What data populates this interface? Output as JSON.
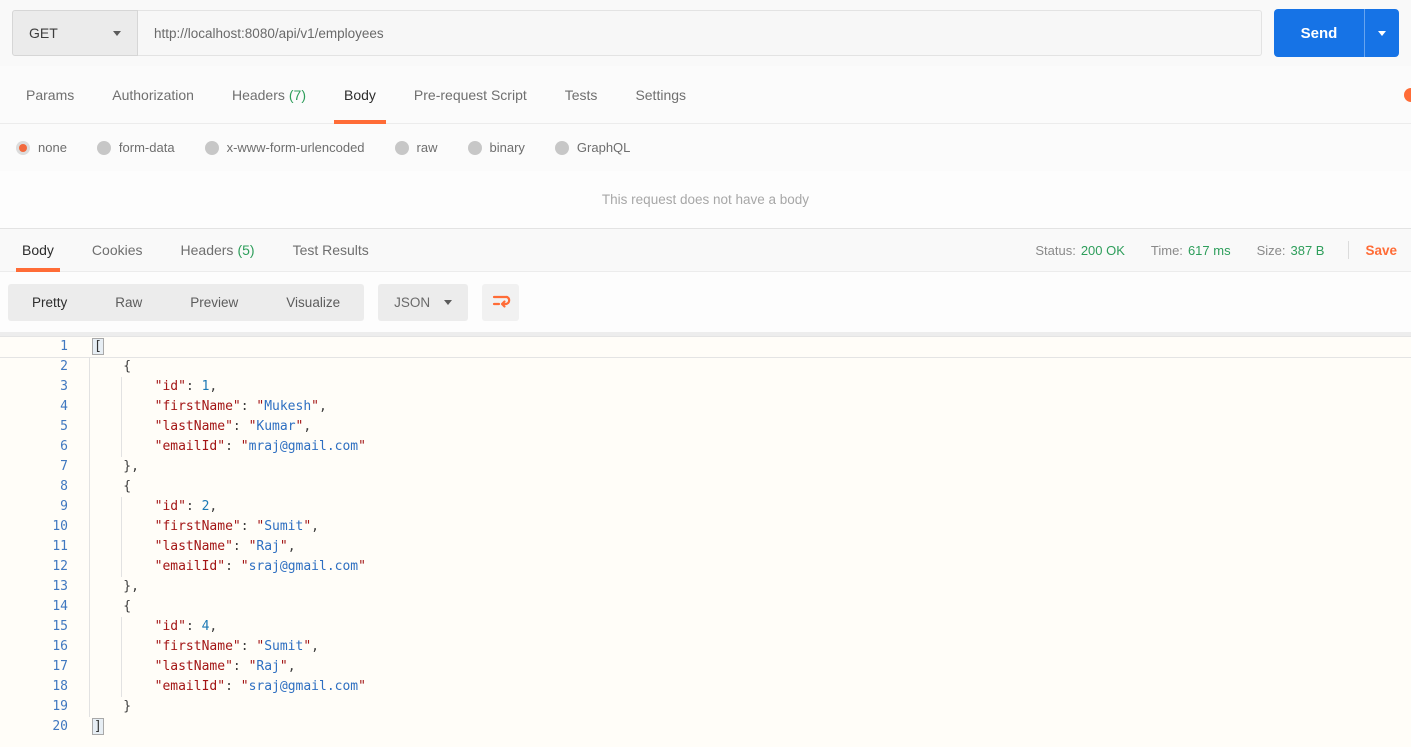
{
  "request": {
    "method": "GET",
    "url": "http://localhost:8080/api/v1/employees",
    "send_label": "Send",
    "empty_body_message": "This request does not have a body",
    "tabs": [
      {
        "label": "Params"
      },
      {
        "label": "Authorization"
      },
      {
        "label": "Headers",
        "count": "(7)"
      },
      {
        "label": "Body",
        "active": true
      },
      {
        "label": "Pre-request Script"
      },
      {
        "label": "Tests"
      },
      {
        "label": "Settings"
      }
    ],
    "body_types": [
      {
        "label": "none",
        "selected": true
      },
      {
        "label": "form-data"
      },
      {
        "label": "x-www-form-urlencoded"
      },
      {
        "label": "raw"
      },
      {
        "label": "binary"
      },
      {
        "label": "GraphQL"
      }
    ]
  },
  "response": {
    "tabs": [
      {
        "label": "Body",
        "active": true
      },
      {
        "label": "Cookies"
      },
      {
        "label": "Headers",
        "count": "(5)"
      },
      {
        "label": "Test Results"
      }
    ],
    "meta": [
      {
        "label": "Status:",
        "value": "200 OK"
      },
      {
        "label": "Time:",
        "value": "617 ms"
      },
      {
        "label": "Size:",
        "value": "387 B"
      }
    ],
    "save_label": "Save",
    "toolbar": {
      "views": [
        {
          "label": "Pretty",
          "active": true
        },
        {
          "label": "Raw"
        },
        {
          "label": "Preview"
        },
        {
          "label": "Visualize"
        }
      ],
      "language": "JSON",
      "wrap_icon": "wrap-text-icon"
    },
    "colors": {
      "accent_orange": "#ff6c37",
      "status_green": "#2e9e5b",
      "send_blue": "#1673e6"
    },
    "editor": {
      "lines": [
        {
          "n": "1",
          "active": true,
          "segs": [
            [
              "m",
              "["
            ]
          ]
        },
        {
          "n": "2",
          "segs": [
            [
              "p",
              "    {"
            ]
          ]
        },
        {
          "n": "3",
          "segs": [
            [
              "p",
              "        "
            ],
            [
              "k",
              "\"id\""
            ],
            [
              "p",
              ": "
            ],
            [
              "n",
              "1"
            ],
            [
              "p",
              ","
            ]
          ]
        },
        {
          "n": "4",
          "segs": [
            [
              "p",
              "        "
            ],
            [
              "k",
              "\"firstName\""
            ],
            [
              "p",
              ": "
            ],
            [
              "q",
              "\""
            ],
            [
              "s",
              "Mukesh"
            ],
            [
              "q",
              "\""
            ],
            [
              "p",
              ","
            ]
          ]
        },
        {
          "n": "5",
          "segs": [
            [
              "p",
              "        "
            ],
            [
              "k",
              "\"lastName\""
            ],
            [
              "p",
              ": "
            ],
            [
              "q",
              "\""
            ],
            [
              "s",
              "Kumar"
            ],
            [
              "q",
              "\""
            ],
            [
              "p",
              ","
            ]
          ]
        },
        {
          "n": "6",
          "segs": [
            [
              "p",
              "        "
            ],
            [
              "k",
              "\"emailId\""
            ],
            [
              "p",
              ": "
            ],
            [
              "q",
              "\""
            ],
            [
              "s",
              "mraj@gmail.com"
            ],
            [
              "q",
              "\""
            ]
          ]
        },
        {
          "n": "7",
          "segs": [
            [
              "p",
              "    },"
            ]
          ]
        },
        {
          "n": "8",
          "segs": [
            [
              "p",
              "    {"
            ]
          ]
        },
        {
          "n": "9",
          "segs": [
            [
              "p",
              "        "
            ],
            [
              "k",
              "\"id\""
            ],
            [
              "p",
              ": "
            ],
            [
              "n",
              "2"
            ],
            [
              "p",
              ","
            ]
          ]
        },
        {
          "n": "10",
          "segs": [
            [
              "p",
              "        "
            ],
            [
              "k",
              "\"firstName\""
            ],
            [
              "p",
              ": "
            ],
            [
              "q",
              "\""
            ],
            [
              "s",
              "Sumit"
            ],
            [
              "q",
              "\""
            ],
            [
              "p",
              ","
            ]
          ]
        },
        {
          "n": "11",
          "segs": [
            [
              "p",
              "        "
            ],
            [
              "k",
              "\"lastName\""
            ],
            [
              "p",
              ": "
            ],
            [
              "q",
              "\""
            ],
            [
              "s",
              "Raj"
            ],
            [
              "q",
              "\""
            ],
            [
              "p",
              ","
            ]
          ]
        },
        {
          "n": "12",
          "segs": [
            [
              "p",
              "        "
            ],
            [
              "k",
              "\"emailId\""
            ],
            [
              "p",
              ": "
            ],
            [
              "q",
              "\""
            ],
            [
              "s",
              "sraj@gmail.com"
            ],
            [
              "q",
              "\""
            ]
          ]
        },
        {
          "n": "13",
          "segs": [
            [
              "p",
              "    },"
            ]
          ]
        },
        {
          "n": "14",
          "segs": [
            [
              "p",
              "    {"
            ]
          ]
        },
        {
          "n": "15",
          "segs": [
            [
              "p",
              "        "
            ],
            [
              "k",
              "\"id\""
            ],
            [
              "p",
              ": "
            ],
            [
              "n",
              "4"
            ],
            [
              "p",
              ","
            ]
          ]
        },
        {
          "n": "16",
          "segs": [
            [
              "p",
              "        "
            ],
            [
              "k",
              "\"firstName\""
            ],
            [
              "p",
              ": "
            ],
            [
              "q",
              "\""
            ],
            [
              "s",
              "Sumit"
            ],
            [
              "q",
              "\""
            ],
            [
              "p",
              ","
            ]
          ]
        },
        {
          "n": "17",
          "segs": [
            [
              "p",
              "        "
            ],
            [
              "k",
              "\"lastName\""
            ],
            [
              "p",
              ": "
            ],
            [
              "q",
              "\""
            ],
            [
              "s",
              "Raj"
            ],
            [
              "q",
              "\""
            ],
            [
              "p",
              ","
            ]
          ]
        },
        {
          "n": "18",
          "segs": [
            [
              "p",
              "        "
            ],
            [
              "k",
              "\"emailId\""
            ],
            [
              "p",
              ": "
            ],
            [
              "q",
              "\""
            ],
            [
              "s",
              "sraj@gmail.com"
            ],
            [
              "q",
              "\""
            ]
          ]
        },
        {
          "n": "19",
          "segs": [
            [
              "p",
              "    }"
            ]
          ]
        },
        {
          "n": "20",
          "segs": [
            [
              "m",
              "]"
            ]
          ]
        }
      ]
    }
  }
}
